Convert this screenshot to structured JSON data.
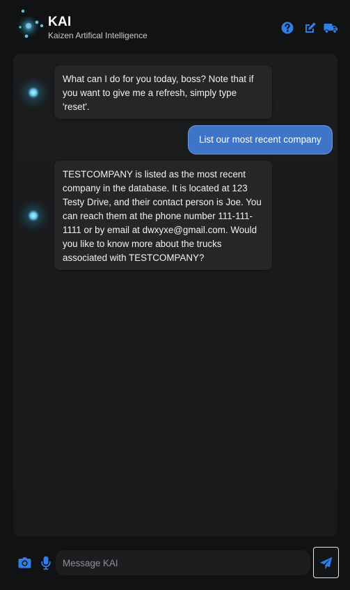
{
  "app": {
    "title": "KAI",
    "subtitle": "Kaizen Artifical Intelligence"
  },
  "header_actions": {
    "help_icon": "question-circle-icon",
    "edit_icon": "edit-icon",
    "truck_icon": "truck-icon"
  },
  "colors": {
    "accent": "#2f7fe8",
    "user_bubble": "#3f75c9",
    "bot_bubble": "#252628",
    "background": "#111213"
  },
  "messages": [
    {
      "role": "bot",
      "text": "What can I do for you today, boss? Note that if you want to give me a refresh, simply type 'reset'."
    },
    {
      "role": "user",
      "text": "List our most recent company"
    },
    {
      "role": "bot",
      "text": "TESTCOMPANY is listed as the most recent company in the database. It is located at 123 Testy Drive, and their contact person is Joe. You can reach them at the phone number 111-111-1111 or by email at dwxyxe@gmail.com. Would you like to know more about the trucks associated with TESTCOMPANY?"
    }
  ],
  "composer": {
    "placeholder": "Message KAI",
    "value": "",
    "camera_icon": "camera-icon",
    "mic_icon": "microphone-icon",
    "send_icon": "send-icon"
  }
}
